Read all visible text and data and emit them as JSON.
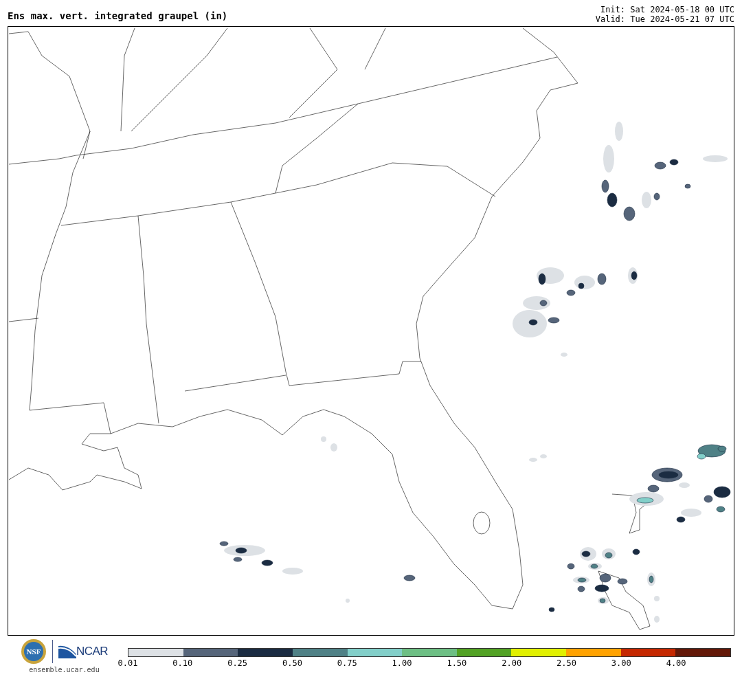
{
  "title": "Ens max. vert. integrated graupel (in)",
  "init": "Init: Sat 2024-05-18 00 UTC",
  "valid": "Valid: Tue 2024-05-21 07 UTC",
  "logo": {
    "badge": "NSF",
    "name": "NCAR",
    "url": "ensemble.ucar.edu"
  },
  "colorbar": {
    "bins": [
      {
        "label": "0.01",
        "color": "#dde1e5"
      },
      {
        "label": "0.10",
        "color": "#56657a"
      },
      {
        "label": "0.25",
        "color": "#1b2c42"
      },
      {
        "label": "0.50",
        "color": "#4f8186"
      },
      {
        "label": "0.75",
        "color": "#82cfc9"
      },
      {
        "label": "1.00",
        "color": "#6dbf84"
      },
      {
        "label": "1.50",
        "color": "#52a224"
      },
      {
        "label": "2.00",
        "color": "#e1f000"
      },
      {
        "label": "2.50",
        "color": "#ffa200"
      },
      {
        "label": "3.00",
        "color": "#c52800"
      },
      {
        "label": "4.00",
        "color": "#631808"
      }
    ]
  }
}
